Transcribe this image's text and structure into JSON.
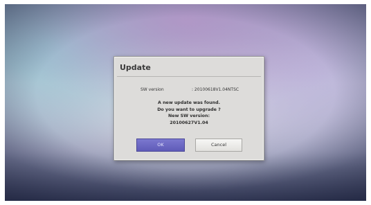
{
  "dialog": {
    "title": "Update",
    "sw_version_label": "SW version",
    "sw_version_value": ": 20100618V1.04NTSC",
    "message_lines": [
      "A new update was found.",
      "Do you want to upgrade ?",
      "New SW version:",
      "20100627V1.04"
    ],
    "ok_label": "OK",
    "cancel_label": "Cancel"
  },
  "colors": {
    "dialog_bg": "#dddcda",
    "ok_button": "#6b68c4",
    "cancel_button": "#f0efed"
  }
}
